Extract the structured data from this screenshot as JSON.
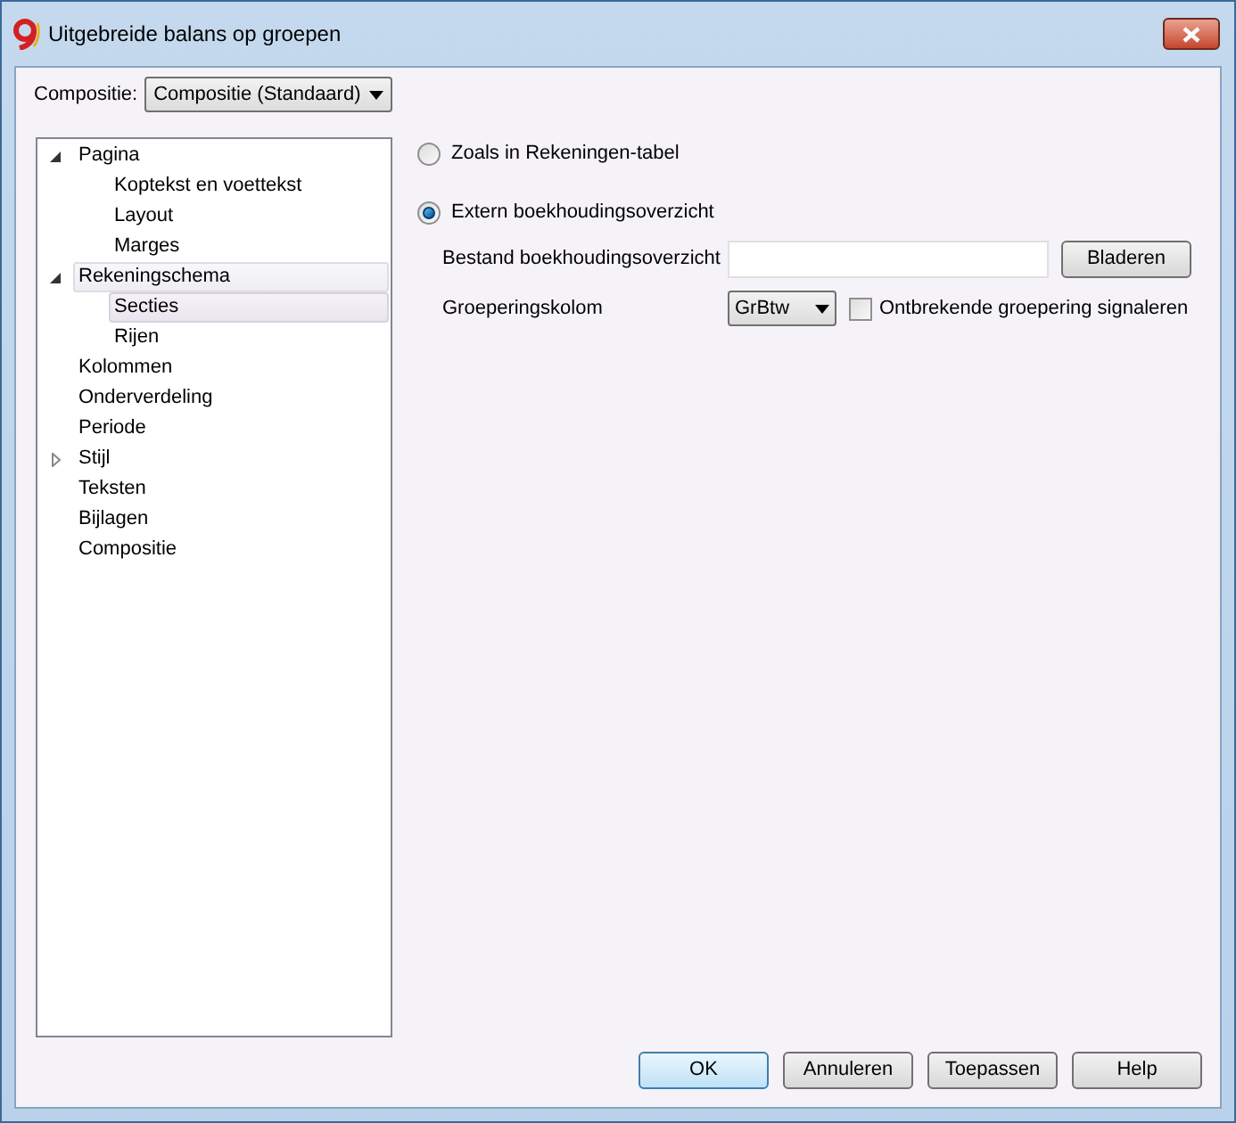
{
  "window": {
    "title": "Uitgebreide balans op groepen"
  },
  "composition": {
    "label": "Compositie:",
    "value": "Compositie (Standaard)"
  },
  "tree": [
    {
      "label": "Pagina",
      "expanded": true,
      "selected": false,
      "hovered": false,
      "children": [
        {
          "label": "Koptekst en voettekst",
          "selected": false,
          "hovered": false
        },
        {
          "label": "Layout",
          "selected": false,
          "hovered": false
        },
        {
          "label": "Marges",
          "selected": false,
          "hovered": false
        }
      ]
    },
    {
      "label": "Rekeningschema",
      "expanded": true,
      "selected": false,
      "hovered": true,
      "children": [
        {
          "label": "Secties",
          "selected": true,
          "hovered": false
        },
        {
          "label": "Rijen",
          "selected": false,
          "hovered": false
        }
      ]
    },
    {
      "label": "Kolommen",
      "selected": false,
      "hovered": false
    },
    {
      "label": "Onderverdeling",
      "selected": false,
      "hovered": false
    },
    {
      "label": "Periode",
      "selected": false,
      "hovered": false
    },
    {
      "label": "Stijl",
      "expanded": false,
      "selected": false,
      "hovered": false
    },
    {
      "label": "Teksten",
      "selected": false,
      "hovered": false
    },
    {
      "label": "Bijlagen",
      "selected": false,
      "hovered": false
    },
    {
      "label": "Compositie",
      "selected": false,
      "hovered": false
    }
  ],
  "options": [
    {
      "label": "Zoals in Rekeningen-tabel",
      "selected": false
    },
    {
      "label": "Extern boekhoudingsoverzicht",
      "selected": true
    }
  ],
  "file_field": {
    "label": "Bestand boekhoudingsoverzicht",
    "button": "Bladeren"
  },
  "grouping": {
    "label": "Groeperingskolom",
    "value": "GrBtw",
    "checkbox": {
      "label": "Ontbrekende groepering signaleren",
      "checked": false
    }
  },
  "buttons": [
    {
      "label": "OK",
      "default": true
    },
    {
      "label": "Annuleren",
      "default": false
    },
    {
      "label": "Toepassen",
      "default": false
    },
    {
      "label": "Help",
      "default": false
    }
  ]
}
